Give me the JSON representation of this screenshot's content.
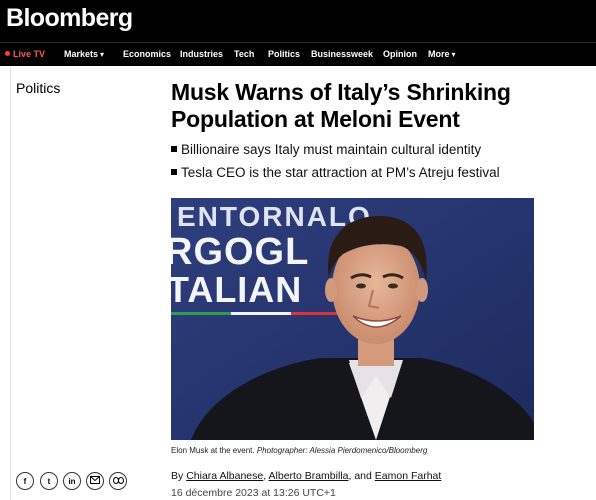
{
  "header": {
    "logo": "Bloomberg"
  },
  "nav": {
    "live": "Live TV",
    "items": [
      "Markets",
      "Economics",
      "Industries",
      "Tech",
      "Politics",
      "Businessweek",
      "Opinion",
      "More"
    ]
  },
  "article": {
    "section": "Politics",
    "headline": "Musk Warns of Italy’s Shrinking Population at Meloni Event",
    "bullets": [
      "Billionaire says Italy must maintain cultural identity",
      "Tesla CEO is the star attraction at PM’s Atreju festival"
    ],
    "image": {
      "backdrop_text": [
        "ENTORNALO",
        "RGOGL",
        "TALIAN"
      ]
    },
    "caption": {
      "text": "Elon Musk at the event.",
      "credit": "Photographer: Alessia Pierdomenico/Bloomberg"
    },
    "byline": {
      "prefix": "By",
      "authors": [
        "Chiara Albanese",
        "Alberto Brambilla",
        "Eamon Farhat"
      ],
      "sep": ",",
      "and": "and"
    },
    "date": "16 décembre 2023 at 13:26 UTC+1"
  },
  "share": {
    "facebook": "f",
    "twitter": "t",
    "linkedin": "in",
    "email": "mail",
    "link": "link"
  }
}
